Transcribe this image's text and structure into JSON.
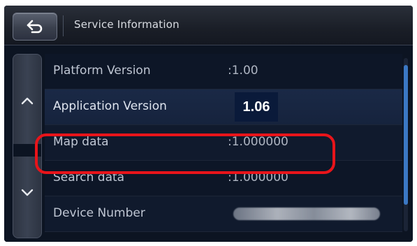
{
  "header": {
    "title": "Service Information",
    "back_icon": "back-arrow-icon"
  },
  "nav": {
    "up_icon": "chevron-up-icon",
    "down_icon": "chevron-down-icon"
  },
  "rows": [
    {
      "label": "Platform Version",
      "value": ":1.00"
    },
    {
      "label": "Application Version",
      "value": "1.06"
    },
    {
      "label": "Map data",
      "value": ":1.000000"
    },
    {
      "label": "Search data",
      "value": ":1.000000"
    },
    {
      "label": "Device Number",
      "value": ""
    }
  ],
  "colors": {
    "annotation": "#e8141a",
    "scroll_thumb": "#3b78c4",
    "highlight_bg": "#0a1a3a"
  }
}
